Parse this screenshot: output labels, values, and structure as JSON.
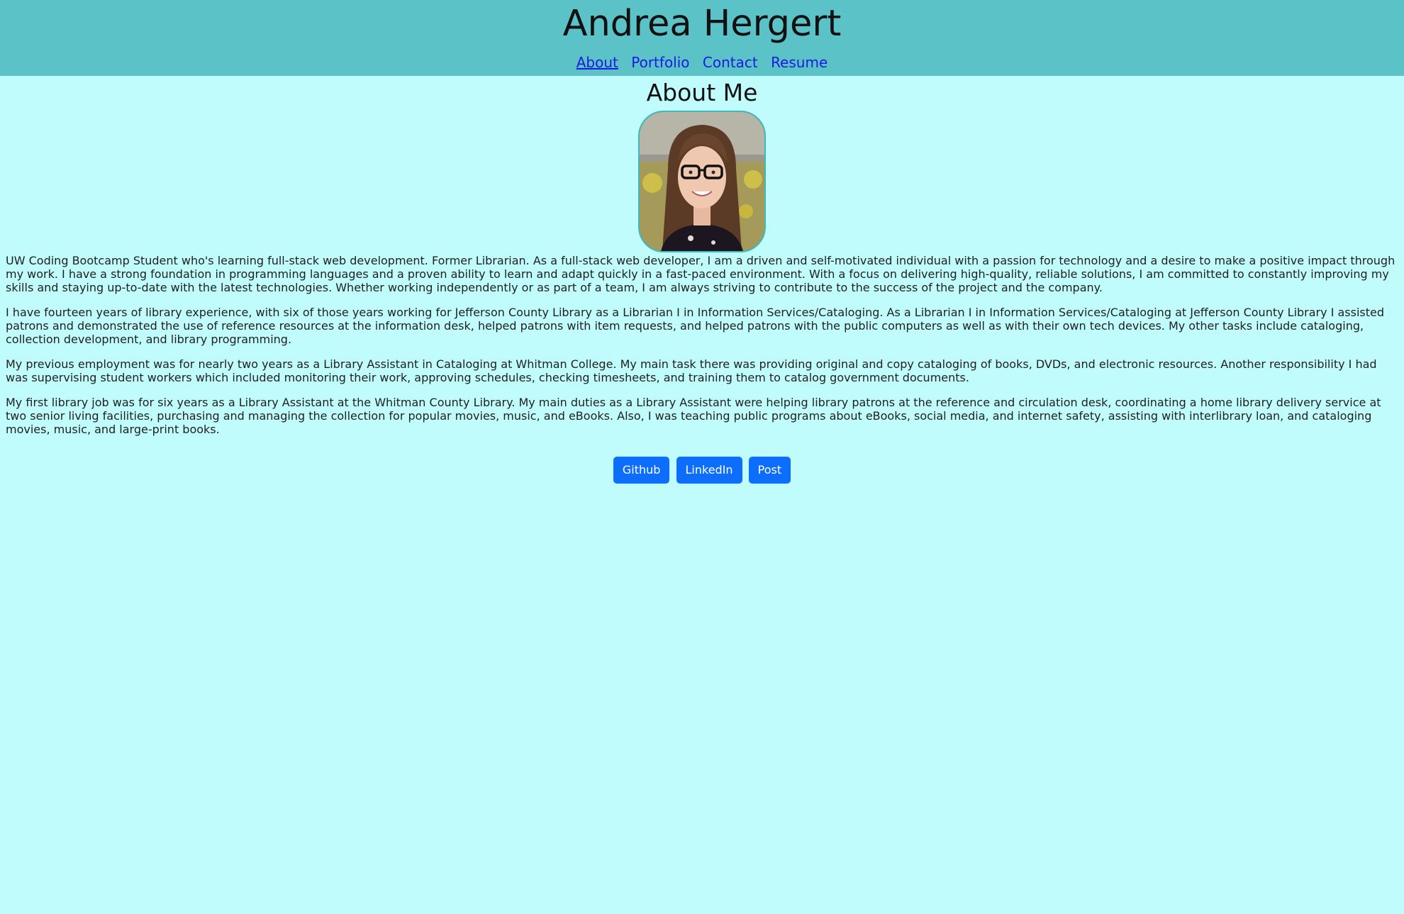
{
  "header": {
    "title": "Andrea Hergert",
    "nav": [
      {
        "label": "About"
      },
      {
        "label": "Portfolio"
      },
      {
        "label": "Contact"
      },
      {
        "label": "Resume"
      }
    ]
  },
  "about": {
    "title": "About Me",
    "paragraphs": [
      "UW Coding Bootcamp Student who's learning full-stack web development. Former Librarian. As a full-stack web developer, I am a driven and self-motivated individual with a passion for technology and a desire to make a positive impact through my work. I have a strong foundation in programming languages and a proven ability to learn and adapt quickly in a fast-paced environment. With a focus on delivering high-quality, reliable solutions, I am committed to constantly improving my skills and staying up-to-date with the latest technologies. Whether working independently or as part of a team, I am always striving to contribute to the success of the project and the company.",
      "I have fourteen years of library experience, with six of those years working for Jefferson County Library as a Librarian I in Information Services/Cataloging. As a Librarian I in Information Services/Cataloging at Jefferson County Library I assisted patrons and demonstrated the use of reference resources at the information desk, helped patrons with item requests, and helped patrons with the public computers as well as with their own tech devices. My other tasks include cataloging, collection development, and library programming.",
      "My previous employment was for nearly two years as a Library Assistant in Cataloging at Whitman College. My main task there was providing original and copy cataloging of books, DVDs, and electronic resources. Another responsibility I had was supervising student workers which included monitoring their work, approving schedules, checking timesheets, and training them to catalog government documents.",
      "My first library job was for six years as a Library Assistant at the Whitman County Library. My main duties as a Library Assistant were helping library patrons at the reference and circulation desk, coordinating a home library delivery service at two senior living facilities, purchasing and managing the collection for popular movies, music, and eBooks. Also, I was teaching public programs about eBooks, social media, and internet safety, assisting with interlibrary loan, and cataloging movies, music, and large-print books."
    ]
  },
  "buttons": [
    {
      "label": "Github"
    },
    {
      "label": "LinkedIn"
    },
    {
      "label": "Post"
    }
  ],
  "colors": {
    "header_bg": "#5bc3c7",
    "page_bg": "#c0fcfc",
    "button_bg": "#0d6efd",
    "link": "#1a1ae0"
  }
}
